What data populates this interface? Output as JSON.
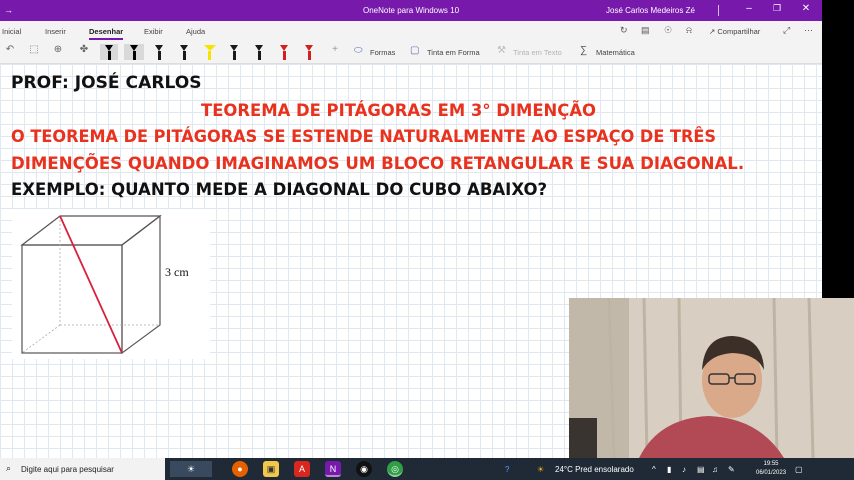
{
  "window": {
    "title": "OneNote para Windows 10",
    "user": "José Carlos Medeiros Zé"
  },
  "ribbon": {
    "tabs": [
      "Inicial",
      "Inserir",
      "Desenhar",
      "Exibir",
      "Ajuda"
    ],
    "active_tab": "Desenhar",
    "share_label": "Compartilhar"
  },
  "draw_toolbar": {
    "pen_colors": [
      "#000000",
      "#000000",
      "#1a1a1a",
      "#1a1a1a",
      "#f5e400",
      "#1a1a1a",
      "#1a1a1a",
      "#d02020",
      "#d02020"
    ],
    "shapes_label": "Formas",
    "ink_to_shape_label": "Tinta em Forma",
    "ink_to_text_label": "Tinta em Texto",
    "math_label": "Matemática"
  },
  "page": {
    "author_line": "PROF: JOSÉ CARLOS",
    "title_line": "TEOREMA DE PITÁGORAS EM 3° DIMENÇÃO",
    "body_line_1": "O TEOREMA DE PITÁGORAS SE ESTENDE NATURALMENTE AO ESPAÇO DE TRÊS",
    "body_line_2": "DIMENÇÕES QUANDO IMAGINAMOS UM BLOCO RETANGULAR E SUA DIAGONAL.",
    "example_line": "EXEMPLO: QUANTO MEDE A DIAGONAL DO CUBO ABAIXO?",
    "cube_edge_label": "3 cm",
    "colors": {
      "black_text": "#111111",
      "red_text": "#e8321e"
    }
  },
  "taskbar": {
    "search_placeholder": "Digite aqui para pesquisar",
    "weather": "24°C  Pred ensolarado",
    "time": "19:55",
    "date": "06/01/2023"
  }
}
